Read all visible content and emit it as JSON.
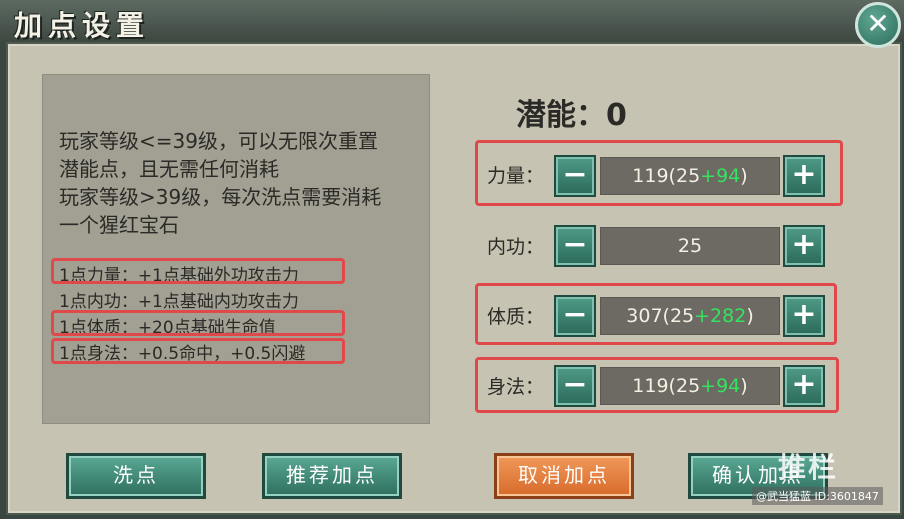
{
  "window": {
    "title": "加点设置",
    "close_label": "✕"
  },
  "info": {
    "lines": [
      "玩家等级<=39级，可以无限次重置",
      "潜能点，且无需任何消耗",
      "玩家等级>39级，每次洗点需要消耗",
      "一个猩红宝石"
    ],
    "bonuses": [
      "1点力量：+1点基础外功攻击力",
      "1点内功：+1点基础内功攻击力",
      "1点体质：+20点基础生命值",
      "1点身法：+0.5命中，+0.5闪避"
    ]
  },
  "potential": {
    "label": "潜能：0"
  },
  "stats": [
    {
      "label": "力量：",
      "base": "119(25",
      "bonus": "+94",
      "close": ")"
    },
    {
      "label": "内功：",
      "base": "25",
      "bonus": "",
      "close": ""
    },
    {
      "label": "体质：",
      "base": "307(25",
      "bonus": "+282",
      "close": ")"
    },
    {
      "label": "身法：",
      "base": "119(25",
      "bonus": "+94",
      "close": ")"
    }
  ],
  "controls": {
    "minus": "−",
    "plus": "+"
  },
  "buttons": {
    "reset": "洗点",
    "recommend": "推荐加点",
    "cancel": "取消加点",
    "confirm": "确认加点"
  },
  "watermark": {
    "big": "推栏",
    "small": "@武当猛蓝  ID:3601847"
  },
  "colors": {
    "accent_teal": "#2f6f5f",
    "cancel_orange": "#e07a38",
    "highlight_red": "#e0484a",
    "bonus_green": "#34e35f"
  }
}
